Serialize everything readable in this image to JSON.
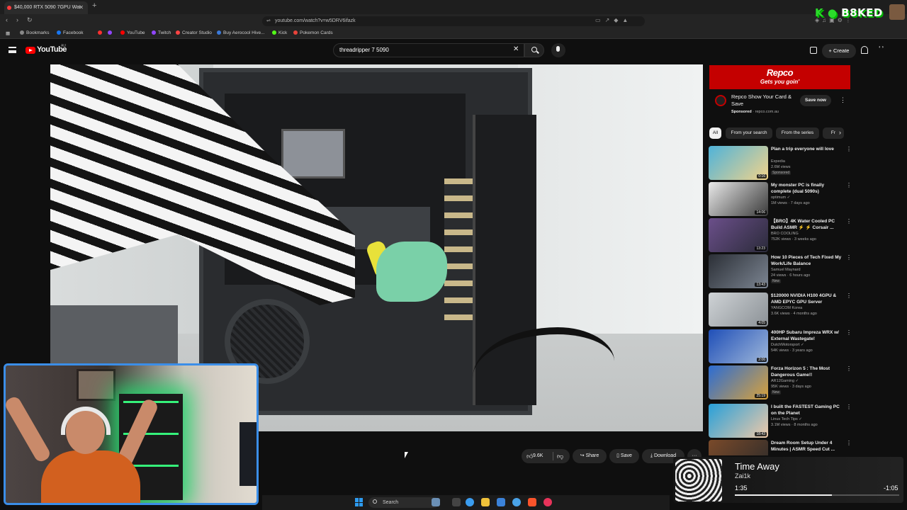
{
  "browser": {
    "tab_title": "$40,000 RTX 5090 7GPU Wat",
    "url": "youtube.com/watch?v=w5DRV6ifazk",
    "bookmarks": [
      "Bookmarks",
      "Facebook",
      "YouTube",
      "Twitch",
      "Creator Studio",
      "Buy Aerocool Hive...",
      "Kick",
      "Pokemon Cards"
    ]
  },
  "overlay": {
    "logo_text": "B8KED"
  },
  "youtube": {
    "logo_text": "YouTube",
    "country_code": "AU",
    "search_query": "threadripper 7 5090",
    "create_label": "Create"
  },
  "video_actions": {
    "likes": "9.6K",
    "share_label": "Share",
    "save_label": "Save",
    "download_label": "Download",
    "more_label": "···"
  },
  "ad": {
    "brand": "Repco",
    "slogan": "Gets you goin'",
    "title": "Repco Show Your Card & Save",
    "sponsored_label": "Sponsored",
    "domain": "repco.com.au",
    "cta": "Save now"
  },
  "chips": [
    "All",
    "From your search",
    "From the series",
    "Fr"
  ],
  "recommendations": [
    {
      "title": "Plan a trip everyone will love",
      "channel": "Expedia",
      "meta": "2.6M views",
      "badge": "Sponsored",
      "duration": "0:16",
      "color_a": "#4fb3d9",
      "color_b": "#f2d38a"
    },
    {
      "title": "My monster PC is finally complete (dual 5090s)",
      "channel": "optimum ✓",
      "meta": "1M views · 7 days ago",
      "badge": "",
      "duration": "14:06",
      "color_a": "#e9e9e9",
      "color_b": "#3a3a3a"
    },
    {
      "title": "【BRO】4K Water Cooled PC Build ASMR ⚡ ⚡ Corsair ...",
      "channel": "BRO COOLING",
      "meta": "752K views · 3 weeks ago",
      "badge": "",
      "duration": "13:23",
      "color_a": "#6b4f8a",
      "color_b": "#2b2b3a"
    },
    {
      "title": "How 10 Pieces of Tech Fixed My Work/Life Balance",
      "channel": "Samuel Maynard",
      "meta": "24 views · 6 hours ago",
      "badge": "New",
      "duration": "13:43",
      "color_a": "#2b2f36",
      "color_b": "#7c8592"
    },
    {
      "title": "$120000 NVIDIA H100 4GPU & AMD EPYC GPU Server",
      "channel": "YANGCOM Korea",
      "meta": "3.6K views · 4 months ago",
      "badge": "",
      "duration": "4:05",
      "color_a": "#cfd3d6",
      "color_b": "#8b9196"
    },
    {
      "title": "400HP Subaru Impreza WRX w/ External Wastegate!",
      "channel": "DutchMotorsport ✓",
      "meta": "54K views · 3 years ago",
      "badge": "",
      "duration": "2:06",
      "color_a": "#1f4fb8",
      "color_b": "#9fb7d9"
    },
    {
      "title": "Forza Horizon 5 : The Most Dangerous Game!!",
      "channel": "AR12Gaming ✓",
      "meta": "95K views · 3 days ago",
      "badge": "New",
      "duration": "25:19",
      "color_a": "#2b6cd4",
      "color_b": "#d9a23a"
    },
    {
      "title": "I built the FASTEST Gaming PC on the Planet",
      "channel": "Linus Tech Tips ✓",
      "meta": "3.1M views · 8 months ago",
      "badge": "",
      "duration": "18:43",
      "color_a": "#27a0d9",
      "color_b": "#f0c9a8"
    },
    {
      "title": "Dream Room Setup Under 4 Minutes | ASMR Speed Cut ...",
      "channel": "",
      "meta": "",
      "badge": "",
      "duration": "",
      "color_a": "#7a4a2a",
      "color_b": "#2a2a2a"
    }
  ],
  "now_playing": {
    "title": "Time Away",
    "artist": "Zai1k",
    "elapsed": "1:35",
    "remaining": "-1:05",
    "progress": 0.59
  },
  "taskbar": {
    "search_label": "Search"
  }
}
